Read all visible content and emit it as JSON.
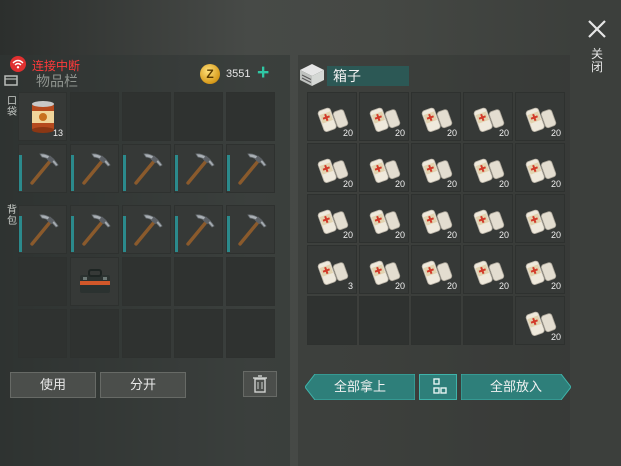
{
  "status": {
    "connection_text": "连接中断"
  },
  "inventory": {
    "title": "物品栏",
    "pocket_label": "口袋",
    "backpack_label": "背包",
    "coins": "3551",
    "coin_symbol": "Z",
    "add_symbol": "+",
    "pocket_slots": [
      {
        "item": "canned-food",
        "qty": "13"
      },
      {
        "item": "empty",
        "qty": ""
      },
      {
        "item": "empty",
        "qty": ""
      },
      {
        "item": "empty",
        "qty": ""
      },
      {
        "item": "empty",
        "qty": ""
      },
      {
        "item": "pickaxe",
        "qty": ""
      },
      {
        "item": "pickaxe",
        "qty": ""
      },
      {
        "item": "pickaxe",
        "qty": ""
      },
      {
        "item": "pickaxe",
        "qty": ""
      },
      {
        "item": "pickaxe",
        "qty": ""
      }
    ],
    "backpack_slots": [
      {
        "item": "pickaxe",
        "qty": ""
      },
      {
        "item": "pickaxe",
        "qty": ""
      },
      {
        "item": "pickaxe",
        "qty": ""
      },
      {
        "item": "pickaxe",
        "qty": ""
      },
      {
        "item": "pickaxe",
        "qty": ""
      },
      {
        "item": "empty",
        "qty": ""
      },
      {
        "item": "toolbox",
        "qty": ""
      },
      {
        "item": "empty",
        "qty": ""
      },
      {
        "item": "empty",
        "qty": ""
      },
      {
        "item": "empty",
        "qty": ""
      },
      {
        "item": "empty",
        "qty": ""
      },
      {
        "item": "empty",
        "qty": ""
      },
      {
        "item": "empty",
        "qty": ""
      },
      {
        "item": "empty",
        "qty": ""
      },
      {
        "item": "empty",
        "qty": ""
      }
    ],
    "use_label": "使用",
    "split_label": "分开"
  },
  "chest": {
    "title": "箱子",
    "slots": [
      {
        "item": "bandage",
        "qty": "20"
      },
      {
        "item": "bandage",
        "qty": "20"
      },
      {
        "item": "bandage",
        "qty": "20"
      },
      {
        "item": "bandage",
        "qty": "20"
      },
      {
        "item": "bandage",
        "qty": "20"
      },
      {
        "item": "bandage",
        "qty": "20"
      },
      {
        "item": "bandage",
        "qty": "20"
      },
      {
        "item": "bandage",
        "qty": "20"
      },
      {
        "item": "bandage",
        "qty": "20"
      },
      {
        "item": "bandage",
        "qty": "20"
      },
      {
        "item": "bandage",
        "qty": "20"
      },
      {
        "item": "bandage",
        "qty": "20"
      },
      {
        "item": "bandage",
        "qty": "20"
      },
      {
        "item": "bandage",
        "qty": "20"
      },
      {
        "item": "bandage",
        "qty": "20"
      },
      {
        "item": "bandage",
        "qty": "3"
      },
      {
        "item": "bandage",
        "qty": "20"
      },
      {
        "item": "bandage",
        "qty": "20"
      },
      {
        "item": "bandage",
        "qty": "20"
      },
      {
        "item": "bandage",
        "qty": "20"
      },
      {
        "item": "empty",
        "qty": ""
      },
      {
        "item": "empty",
        "qty": ""
      },
      {
        "item": "empty",
        "qty": ""
      },
      {
        "item": "empty",
        "qty": ""
      },
      {
        "item": "bandage",
        "qty": "20"
      }
    ],
    "take_all_label": "全部拿上",
    "put_all_label": "全部放入"
  },
  "close_label": "关闭",
  "colors": {
    "accent": "#2fc7a4",
    "teal_button": "#2e7f7a",
    "alert": "#ff3a3a"
  },
  "icons": [
    "wifi-icon",
    "box-icon",
    "coin-icon",
    "plus-icon",
    "canned-food-icon",
    "pickaxe-icon",
    "toolbox-icon",
    "trash-icon",
    "chest-icon",
    "bandage-icon",
    "sort-icon",
    "close-icon"
  ]
}
